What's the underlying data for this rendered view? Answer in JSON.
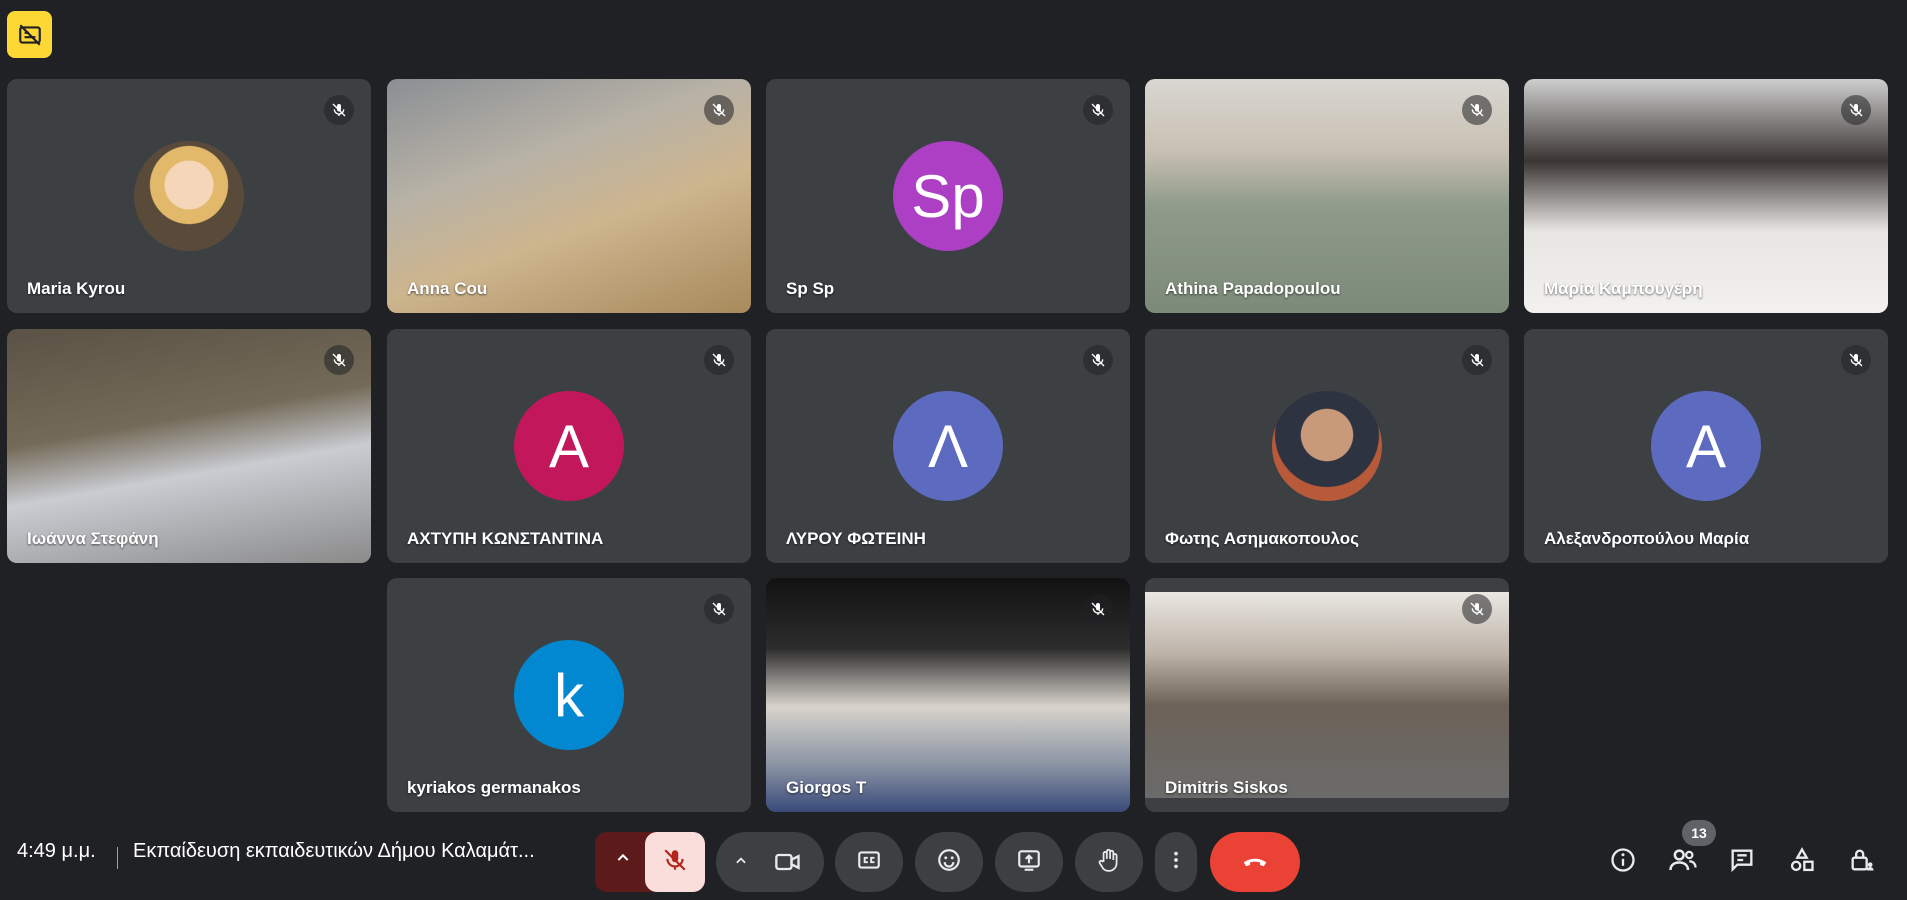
{
  "participants": [
    {
      "name": "Maria Kyrou"
    },
    {
      "name": "Anna Cou"
    },
    {
      "name": "Sp Sp",
      "initials": "Sp",
      "avatar_color": "#ad3fc4"
    },
    {
      "name": "Athina Papadopoulou"
    },
    {
      "name": "Μαρία Καμπουγέρη"
    },
    {
      "name": "Ιωάννα Στεφάνη"
    },
    {
      "name": "ΑΧΤΥΠΗ ΚΩΝΣΤΑΝΤΙΝΑ",
      "initials": "Α",
      "avatar_color": "#c2185b"
    },
    {
      "name": "ΛΥΡΟΥ ΦΩΤΕΙΝΗ",
      "initials": "Λ",
      "avatar_color": "#5c6bc0"
    },
    {
      "name": "Φωτης Ασημακοπουλος"
    },
    {
      "name": "Αλεξανδροπούλου Μαρία",
      "initials": "Α",
      "avatar_color": "#5c6bc0"
    },
    {
      "name": "kyriakos germanakos",
      "initials": "k",
      "avatar_color": "#0288d1"
    },
    {
      "name": "Giorgos T"
    },
    {
      "name": "Dimitris Siskos"
    }
  ],
  "footer": {
    "time": "4:49 μ.μ.",
    "meeting_title": "Εκπαίδευση εκπαιδευτικών Δήμου Καλαμάτ...",
    "participant_count": "13"
  },
  "colors": {
    "background": "#202124",
    "tile": "#3c4043",
    "end_call": "#ea4335",
    "mic_off": "#f9dedc",
    "badge": "#fdd835"
  }
}
